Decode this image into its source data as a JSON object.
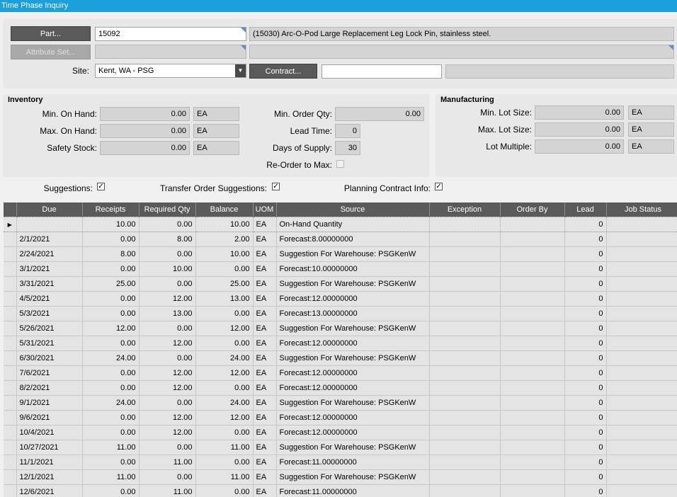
{
  "window": {
    "title": "Time Phase Inquiry"
  },
  "header": {
    "part_button": "Part...",
    "part_value": "15092",
    "part_description": "(15030) Arc-O-Pod Large Replacement Leg Lock Pin, stainless steel.",
    "attribute_set_button": "Attribute Set...",
    "attribute_value": "",
    "attribute_desc": "",
    "site_label": "Site:",
    "site_value": "Kent, WA - PSG",
    "contract_button": "Contract...",
    "contract_value": "",
    "contract_desc": ""
  },
  "inventory": {
    "title": "Inventory",
    "min_on_hand_label": "Min. On Hand:",
    "min_on_hand": "0.00",
    "min_on_hand_uom": "EA",
    "max_on_hand_label": "Max. On Hand:",
    "max_on_hand": "0.00",
    "max_on_hand_uom": "EA",
    "safety_stock_label": "Safety Stock:",
    "safety_stock": "0.00",
    "safety_stock_uom": "EA",
    "min_order_qty_label": "Min. Order Qty:",
    "min_order_qty": "0.00",
    "lead_time_label": "Lead Time:",
    "lead_time": "0",
    "days_of_supply_label": "Days of Supply:",
    "days_of_supply": "30",
    "reorder_to_max_label": "Re-Order to Max:",
    "reorder_to_max": false
  },
  "manufacturing": {
    "title": "Manufacturing",
    "min_lot_size_label": "Min. Lot Size:",
    "min_lot_size": "0.00",
    "min_lot_uom": "EA",
    "max_lot_size_label": "Max. Lot Size:",
    "max_lot_size": "0.00",
    "max_lot_uom": "EA",
    "lot_multiple_label": "Lot Multiple:",
    "lot_multiple": "0.00",
    "lot_multiple_uom": "EA"
  },
  "options": {
    "suggestions_label": "Suggestions:",
    "suggestions": true,
    "transfer_label": "Transfer Order Suggestions:",
    "transfer": true,
    "planning_label": "Planning Contract Info:",
    "planning": true
  },
  "grid": {
    "columns": [
      "Due",
      "Receipts",
      "Required Qty",
      "Balance",
      "UOM",
      "Source",
      "Exception",
      "Order By",
      "Lead",
      "Job Status"
    ],
    "rows": [
      [
        "",
        "10.00",
        "0.00",
        "10.00",
        "EA",
        "On-Hand Quantity",
        "",
        "",
        "0",
        ""
      ],
      [
        "2/1/2021",
        "0.00",
        "8.00",
        "2.00",
        "EA",
        "Forecast:8.00000000",
        "",
        "",
        "0",
        ""
      ],
      [
        "2/24/2021",
        "8.00",
        "0.00",
        "10.00",
        "EA",
        "Suggestion For Warehouse: PSGKenW",
        "",
        "",
        "0",
        ""
      ],
      [
        "3/1/2021",
        "0.00",
        "10.00",
        "0.00",
        "EA",
        "Forecast:10.00000000",
        "",
        "",
        "0",
        ""
      ],
      [
        "3/31/2021",
        "25.00",
        "0.00",
        "25.00",
        "EA",
        "Suggestion For Warehouse: PSGKenW",
        "",
        "",
        "0",
        ""
      ],
      [
        "4/5/2021",
        "0.00",
        "12.00",
        "13.00",
        "EA",
        "Forecast:12.00000000",
        "",
        "",
        "0",
        ""
      ],
      [
        "5/3/2021",
        "0.00",
        "13.00",
        "0.00",
        "EA",
        "Forecast:13.00000000",
        "",
        "",
        "0",
        ""
      ],
      [
        "5/26/2021",
        "12.00",
        "0.00",
        "12.00",
        "EA",
        "Suggestion For Warehouse: PSGKenW",
        "",
        "",
        "0",
        ""
      ],
      [
        "5/31/2021",
        "0.00",
        "12.00",
        "0.00",
        "EA",
        "Forecast:12.00000000",
        "",
        "",
        "0",
        ""
      ],
      [
        "6/30/2021",
        "24.00",
        "0.00",
        "24.00",
        "EA",
        "Suggestion For Warehouse: PSGKenW",
        "",
        "",
        "0",
        ""
      ],
      [
        "7/6/2021",
        "0.00",
        "12.00",
        "12.00",
        "EA",
        "Forecast:12.00000000",
        "",
        "",
        "0",
        ""
      ],
      [
        "8/2/2021",
        "0.00",
        "12.00",
        "0.00",
        "EA",
        "Forecast:12.00000000",
        "",
        "",
        "0",
        ""
      ],
      [
        "9/1/2021",
        "24.00",
        "0.00",
        "24.00",
        "EA",
        "Suggestion For Warehouse: PSGKenW",
        "",
        "",
        "0",
        ""
      ],
      [
        "9/6/2021",
        "0.00",
        "12.00",
        "12.00",
        "EA",
        "Forecast:12.00000000",
        "",
        "",
        "0",
        ""
      ],
      [
        "10/4/2021",
        "0.00",
        "12.00",
        "0.00",
        "EA",
        "Forecast:12.00000000",
        "",
        "",
        "0",
        ""
      ],
      [
        "10/27/2021",
        "11.00",
        "0.00",
        "11.00",
        "EA",
        "Suggestion For Warehouse: PSGKenW",
        "",
        "",
        "0",
        ""
      ],
      [
        "11/1/2021",
        "0.00",
        "11.00",
        "0.00",
        "EA",
        "Forecast:11.00000000",
        "",
        "",
        "0",
        ""
      ],
      [
        "12/1/2021",
        "11.00",
        "0.00",
        "11.00",
        "EA",
        "Suggestion For Warehouse: PSGKenW",
        "",
        "",
        "0",
        ""
      ],
      [
        "12/6/2021",
        "0.00",
        "11.00",
        "0.00",
        "EA",
        "Forecast:11.00000000",
        "",
        "",
        "0",
        ""
      ]
    ]
  }
}
